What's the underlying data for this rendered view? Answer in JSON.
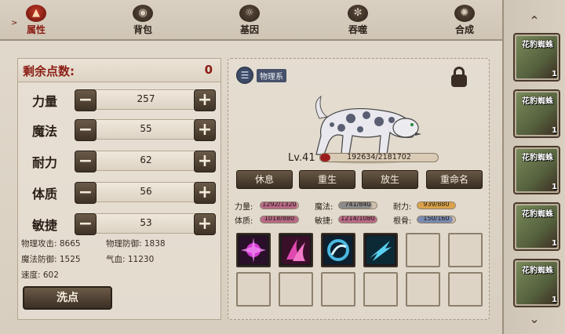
{
  "tabs": [
    {
      "label": "属性",
      "icon": "flame-icon",
      "active": true
    },
    {
      "label": "背包",
      "icon": "bag-icon",
      "active": false
    },
    {
      "label": "基因",
      "icon": "gene-icon",
      "active": false
    },
    {
      "label": "吞噬",
      "icon": "devour-icon",
      "active": false
    },
    {
      "label": "合成",
      "icon": "combine-icon",
      "active": false
    }
  ],
  "attributes": {
    "remaining_label": "剩余点数:",
    "remaining_value": "0",
    "stats": [
      {
        "name": "力量",
        "value": "257"
      },
      {
        "name": "魔法",
        "value": "55"
      },
      {
        "name": "耐力",
        "value": "62"
      },
      {
        "name": "体质",
        "value": "56"
      },
      {
        "name": "敏捷",
        "value": "53"
      }
    ],
    "derived": [
      {
        "text": "物理攻击: 8665"
      },
      {
        "text": "物理防御: 1838"
      },
      {
        "text": "魔法防御: 1525"
      },
      {
        "text": "气血: 11230"
      },
      {
        "text": "速度: 602"
      }
    ],
    "reset_label": "洗点"
  },
  "pet": {
    "type_badge": "物理系",
    "level": "Lv.41",
    "exp_text": "192634/2181702",
    "exp_fraction": 0.088,
    "actions": [
      "休息",
      "重生",
      "放生",
      "重命名"
    ],
    "aptitudes": [
      {
        "label": "力量:",
        "value": "1292/1320",
        "fraction": 0.979,
        "color": "#b86a88"
      },
      {
        "label": "魔法:",
        "value": "741/840",
        "fraction": 0.882,
        "color": "#8a8a8a"
      },
      {
        "label": "耐力:",
        "value": "939/880",
        "fraction": 1.0,
        "color": "#d9a24a"
      },
      {
        "label": "体质:",
        "value": "1018/880",
        "fraction": 1.0,
        "color": "#b86a88"
      },
      {
        "label": "敏捷:",
        "value": "1214/1080",
        "fraction": 1.0,
        "color": "#b86a88"
      },
      {
        "label": "根骨:",
        "value": "150/160",
        "fraction": 0.9375,
        "color": "#7a8ab0"
      }
    ],
    "skills": [
      {
        "icon": "magenta-burst-skill-icon",
        "color": "#c23ac2"
      },
      {
        "icon": "pink-claw-skill-icon",
        "color": "#d84aa8"
      },
      {
        "icon": "blue-swirl-skill-icon",
        "color": "#3a9ac0"
      },
      {
        "icon": "blue-slash-skill-icon",
        "color": "#4ab8d8"
      }
    ],
    "empty_slots": 8
  },
  "pet_list": {
    "items": [
      {
        "name": "花豹蜘蛛",
        "level": "1"
      },
      {
        "name": "花豹蜘蛛",
        "level": "1"
      },
      {
        "name": "花豹蜘蛛",
        "level": "1"
      },
      {
        "name": "花豹蜘蛛",
        "level": "1"
      },
      {
        "name": "花豹蜘蛛",
        "level": "1"
      }
    ]
  }
}
